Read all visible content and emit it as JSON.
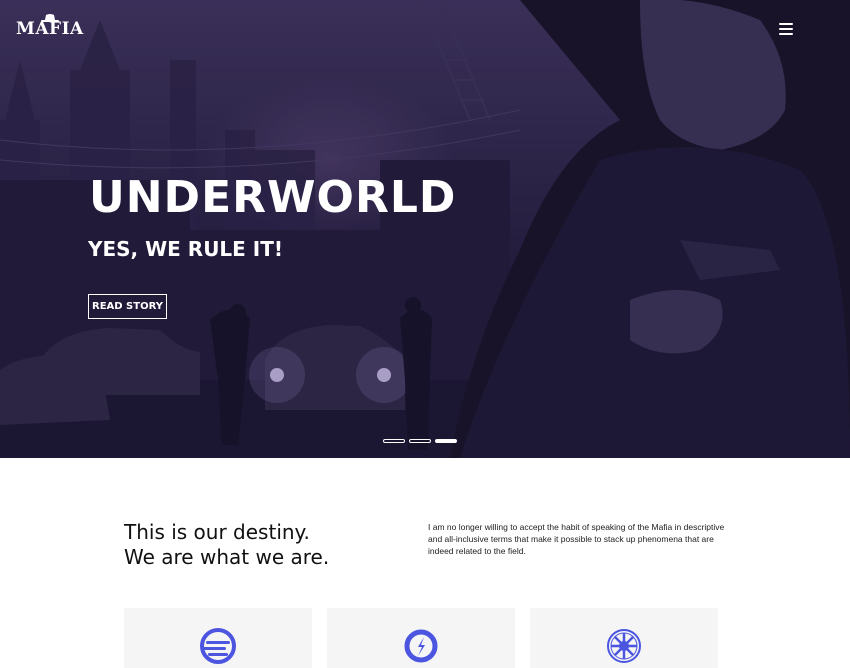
{
  "brand": {
    "logo_text": "MAFIA"
  },
  "nav": {
    "menu_icon": "hamburger-icon"
  },
  "hero": {
    "title": "UNDERWORLD",
    "subtitle": "YES, WE RULE IT!",
    "cta_label": "READ STORY",
    "slides_total": 3,
    "active_slide": 3
  },
  "intro": {
    "title_line1": "This is our destiny.",
    "title_line2": "We are what we are.",
    "text": "I am no longer willing to accept the habit of speaking of the Mafia in descriptive and all-inclusive terms that make it possible to stack up phenomena that are indeed related to the field."
  },
  "features": [
    {
      "icon": "coin-stack-icon"
    },
    {
      "icon": "compass-icon"
    },
    {
      "icon": "emblem-icon"
    }
  ],
  "colors": {
    "accent": "#4c55e0",
    "hero_dark": "#1a1530",
    "card_bg": "#f5f5f5"
  }
}
